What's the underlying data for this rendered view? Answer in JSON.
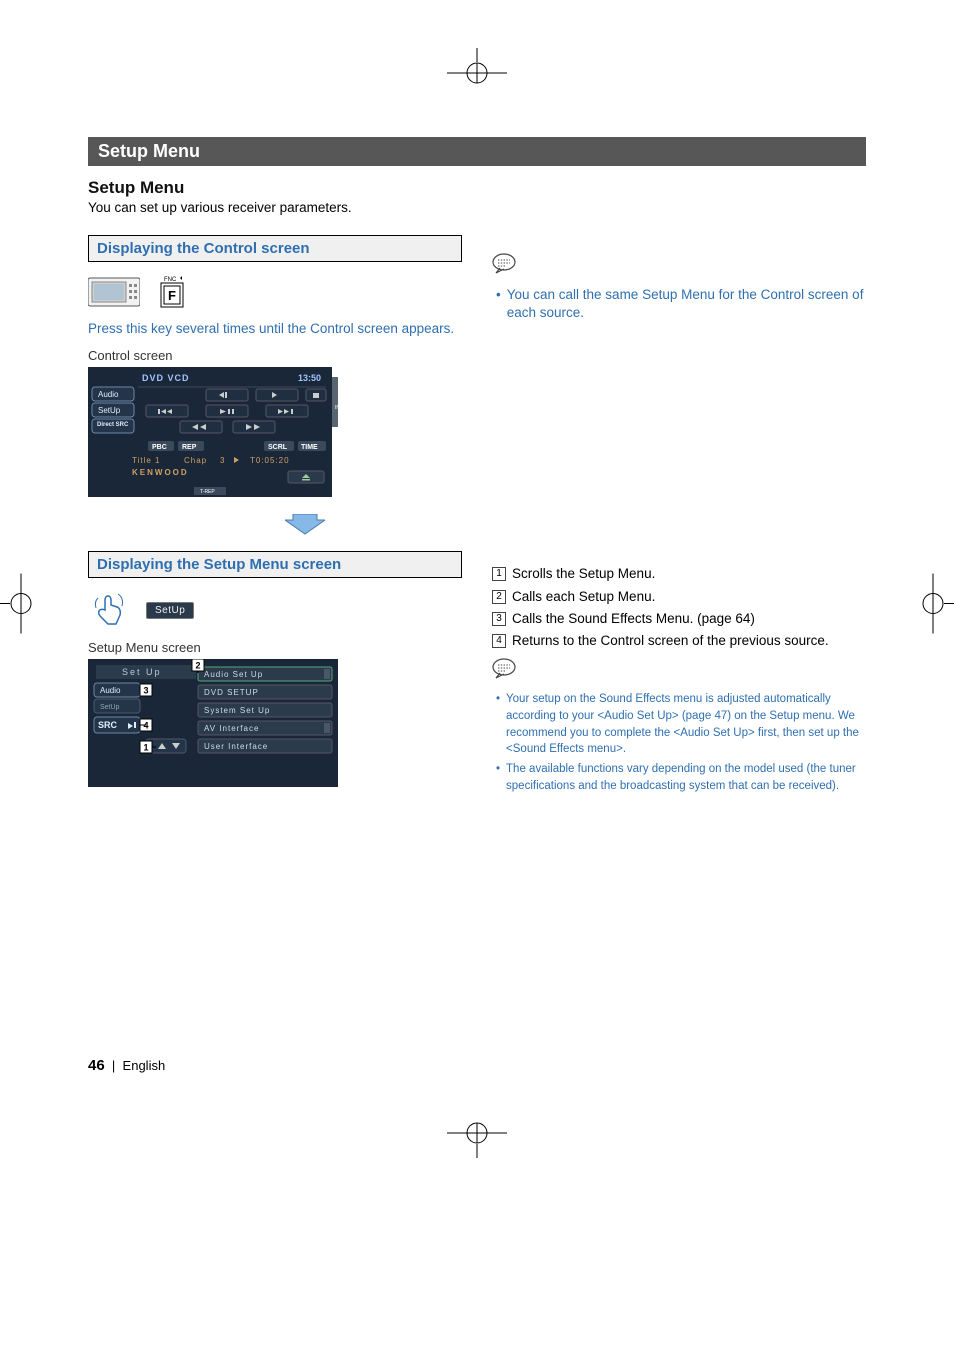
{
  "banner": "Setup Menu",
  "section_title": "Setup Menu",
  "intro": "You can set up various receiver parameters.",
  "left": {
    "card1_title": "Displaying the Control screen",
    "hardkey_label": "F",
    "hardkey_small": "FNC",
    "press_text": "Press this key several times until the Control screen appears.",
    "control_label": "Control screen",
    "screen1": {
      "title": "DVD VCD",
      "time": "13:50",
      "side_btns": [
        "Audio",
        "SetUp",
        "Direct SRC"
      ],
      "tags": [
        "PBC",
        "REP",
        "SCRL",
        "TIME"
      ],
      "info_line_a": "Title 1",
      "info_line_b": "Chap",
      "info_line_c": "3",
      "info_line_d": "T0:05:20",
      "brand": "KENWOOD",
      "trep": "T-REP",
      "in": "IN"
    },
    "card2_title": "Displaying the Setup Menu screen",
    "setup_chip": "SetUp",
    "setup_label": "Setup Menu screen",
    "screen2": {
      "header": "Set Up",
      "left_btns": [
        "Audio",
        "SetUp",
        "SRC"
      ],
      "menu_items": [
        "Audio Set Up",
        "DVD SETUP",
        "System Set Up",
        "AV Interface",
        "User Interface"
      ]
    },
    "callouts": [
      "1",
      "2",
      "3",
      "4"
    ],
    "callout_1": "1",
    "callout_2": "2",
    "callout_3": "3",
    "callout_4": "4"
  },
  "right": {
    "note1": "You can call the same Setup Menu for the Control screen of each source.",
    "list": [
      "Scrolls the Setup Menu.",
      "Calls each Setup Menu.",
      "Calls the Sound Effects Menu. (page 64)",
      "Returns to the Control screen of the previous source."
    ],
    "bullets": [
      "Your setup on the Sound Effects menu is adjusted automatically according to your <Audio Set Up> (page 47) on the Setup menu. We recommend you to complete the <Audio Set Up> first, then set up the <Sound Effects menu>.",
      "The available functions vary depending on the model used (the tuner specifications and the broadcasting system that can be received)."
    ]
  },
  "footer_num": "46",
  "footer_sep": "|",
  "footer_lang": "English"
}
